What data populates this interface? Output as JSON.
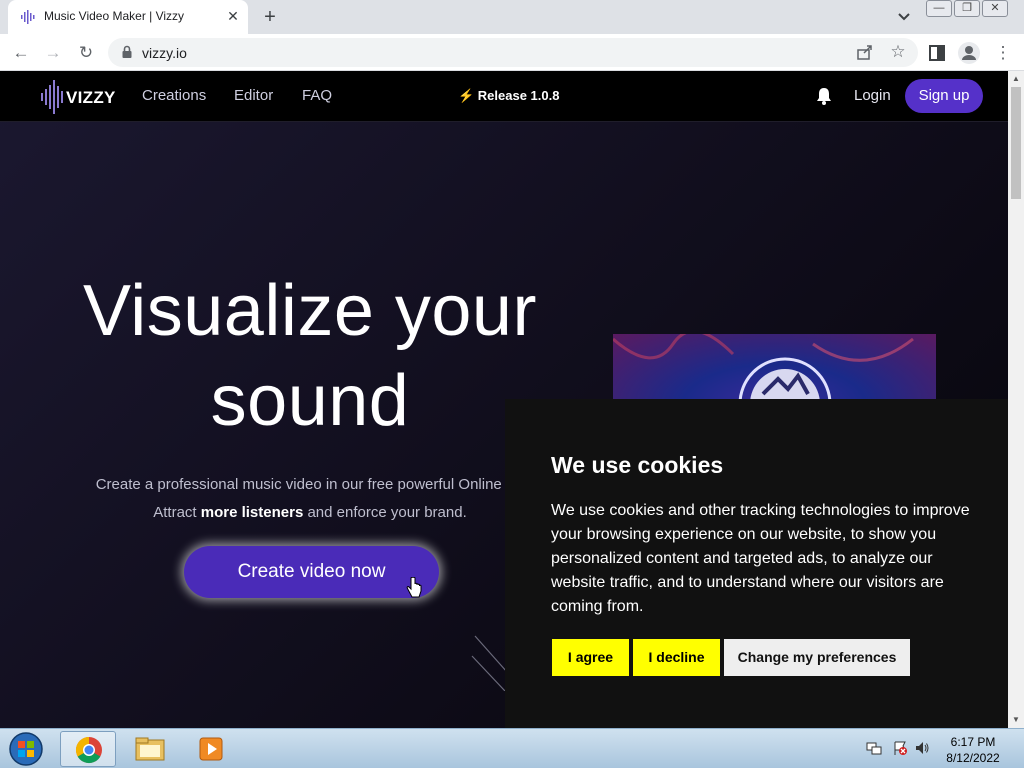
{
  "browser": {
    "tab_title": "Music Video Maker | Vizzy",
    "url": "vizzy.io"
  },
  "nav": {
    "logo_text": "VIZZY",
    "links": [
      "Creations",
      "Editor",
      "FAQ"
    ],
    "release": "⚡ Release 1.0.8",
    "login": "Login",
    "signup": "Sign up"
  },
  "hero": {
    "title_line1": "Visualize your",
    "title_line2": "sound",
    "subtitle_line1": "Create a professional music video in our free powerful Online Ed",
    "subtitle_line2_pre": "Attract ",
    "subtitle_line2_bold": "more listeners",
    "subtitle_line2_post": " and enforce your brand.",
    "cta": "Create video now"
  },
  "cookie": {
    "title": "We use cookies",
    "text": "We use cookies and other tracking technologies to improve your browsing experience on our website, to show you personalized content and targeted ads, to analyze our website traffic, and to understand where our visitors are coming from.",
    "agree": "I agree",
    "decline": "I decline",
    "preferences": "Change my preferences"
  },
  "taskbar": {
    "time": "6:17 PM",
    "date": "8/12/2022"
  },
  "colors": {
    "accent": "#5531c9",
    "cookie_button": "#ffff00"
  }
}
